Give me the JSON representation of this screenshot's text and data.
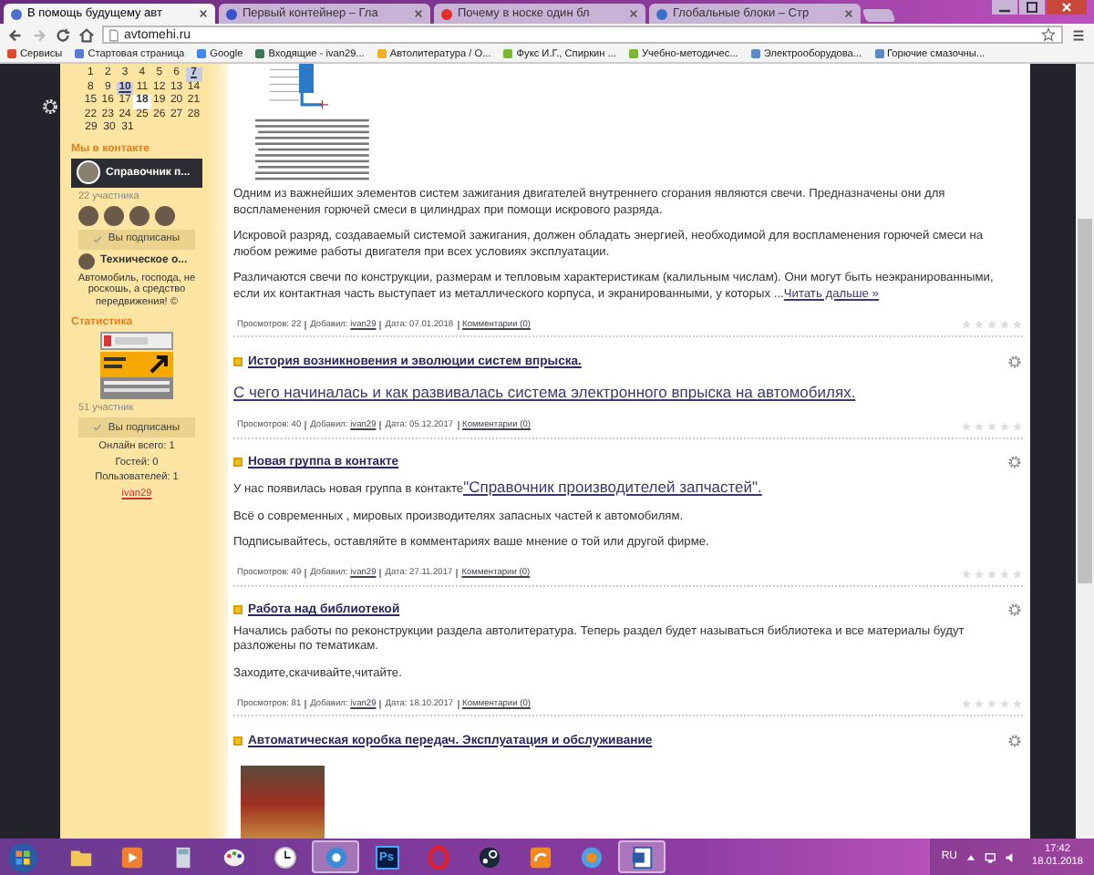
{
  "browser": {
    "tabs": [
      {
        "title": "В помощь будущему авт",
        "selected": true,
        "color": "#4a6fd0"
      },
      {
        "title": "Первый контейнер – Гла",
        "selected": false,
        "color": "#3a52c8"
      },
      {
        "title": "Почему в носке один бл",
        "selected": false,
        "color": "#e0302a"
      },
      {
        "title": "Глобальные блоки – Стр",
        "selected": false,
        "color": "#3a6fc8"
      }
    ],
    "address": "avtomehi.ru",
    "bookmarks": [
      {
        "label": "Сервисы",
        "color": "#e04a2a"
      },
      {
        "label": "Стартовая страница",
        "color": "#5a7ad8"
      },
      {
        "label": "Google",
        "color": "#4285f4"
      },
      {
        "label": "Входящие - ivan29...",
        "color": "#3a7a5a"
      },
      {
        "label": "Автолитература / О...",
        "color": "#f0b020"
      },
      {
        "label": "Фукс И.Г., Спиркин ...",
        "color": "#7ab830"
      },
      {
        "label": "Учебно-методичес...",
        "color": "#7ab830"
      },
      {
        "label": "Электрооборудова...",
        "color": "#5a8ac8"
      },
      {
        "label": "Горючие смазочны...",
        "color": "#5a8ac8"
      }
    ]
  },
  "sidebar": {
    "calendar": [
      [
        {
          "d": "1",
          "kind": "plain"
        },
        {
          "d": "2",
          "kind": "plain"
        },
        {
          "d": "3",
          "kind": "plain"
        },
        {
          "d": "4",
          "kind": "plain"
        },
        {
          "d": "5",
          "kind": "plain"
        },
        {
          "d": "6",
          "kind": "plain"
        },
        {
          "d": "7",
          "kind": "link"
        }
      ],
      [
        {
          "d": "8",
          "kind": "plain"
        },
        {
          "d": "9",
          "kind": "plain"
        },
        {
          "d": "10",
          "kind": "link"
        },
        {
          "d": "11",
          "kind": "plain"
        },
        {
          "d": "12",
          "kind": "plain"
        },
        {
          "d": "13",
          "kind": "plain"
        },
        {
          "d": "14",
          "kind": "plain"
        }
      ],
      [
        {
          "d": "15",
          "kind": "plain"
        },
        {
          "d": "16",
          "kind": "plain"
        },
        {
          "d": "17",
          "kind": "plain"
        },
        {
          "d": "18",
          "kind": "today"
        },
        {
          "d": "19",
          "kind": "plain"
        },
        {
          "d": "20",
          "kind": "plain"
        },
        {
          "d": "21",
          "kind": "plain"
        }
      ],
      [
        {
          "d": "22",
          "kind": "plain"
        },
        {
          "d": "23",
          "kind": "plain"
        },
        {
          "d": "24",
          "kind": "plain"
        },
        {
          "d": "25",
          "kind": "plain"
        },
        {
          "d": "26",
          "kind": "plain"
        },
        {
          "d": "27",
          "kind": "plain"
        },
        {
          "d": "28",
          "kind": "plain"
        }
      ],
      [
        {
          "d": "29",
          "kind": "plain"
        },
        {
          "d": "30",
          "kind": "plain"
        },
        {
          "d": "31",
          "kind": "plain"
        }
      ]
    ],
    "vk_heading": "Мы в контакте",
    "vk_group": "Справочник п...",
    "vk_members": "22 участника",
    "vk_button": "Вы подписаны",
    "vk_group_2": "Техническое о...",
    "quote": "Автомобиль, господа, не роскошь, а средство передвижения! ©",
    "stats_heading": "Статистика",
    "vk_members_2": "51 участник",
    "vk_button_2": "Вы подписаны",
    "online": [
      "Онлайн всего: 1",
      "Гостей: 0",
      "Пользователей: 1"
    ],
    "user": "ivan29"
  },
  "posts": [
    {
      "kind": "diagram",
      "paragraphs": [
        {
          "text": "Одним из важнейших элементов систем зажигания двигателей внутреннего сгорания являются свечи. Предназначены они для воспламенения горючей смеси в цилиндрах при помощи искрового разряда."
        },
        {
          "text": "Искровой разряд, создаваемый системой зажигания, должен обладать энергией, необходимой для воспламенения горючей смеси на любом режиме работы двигателя при всех условиях эксплуатации."
        },
        {
          "text": "Различаются свечи по конструкции, размерам и тепловым характеристикам (калильным числам). Они могут быть неэкранированными, если их контактная часть выступает из металлического корпуса, и экранированными, у которых ...",
          "link": "Читать дальше »"
        }
      ],
      "meta": {
        "views": "Просмотров: 22",
        "added": "Добавил:",
        "author": "ivan29",
        "date": "Дата: 07.01.2018",
        "comments": "Комментарии (0)"
      },
      "stars": 0
    },
    {
      "title": "История возникновения и эволюции систем впрыска.",
      "kind": "text",
      "paragraphs": [
        {
          "link": "С чего начиналась и как развивалась система электронного впрыска на автомобилях.",
          "big": true
        }
      ],
      "meta": {
        "views": "Просмотров: 40",
        "added": "Добавил:",
        "author": "ivan29",
        "date": "Дата: 05.12.2017",
        "comments": "Комментарии (0)"
      },
      "stars": 0
    },
    {
      "title": "Новая группа в контакте",
      "kind": "text",
      "paragraphs": [
        {
          "text": "У нас появилась новая группа в контакте",
          "link": "\"Справочник производителей запчастей\".",
          "big": true
        },
        {
          "text": "Всё о современных , мировых производителях запасных частей к автомобилям."
        },
        {
          "text": "Подписывайтесь, оставляйте в комментариях ваше мнение о той или другой фирме."
        }
      ],
      "meta": {
        "views": "Просмотров: 49",
        "added": "Добавил:",
        "author": "ivan29",
        "date": "Дата: 27.11.2017",
        "comments": "Комментарии (0)"
      },
      "stars": 0
    },
    {
      "title": "Работа над библиотекой",
      "kind": "text",
      "paragraphs": [
        {
          "text": "Начались работы по реконструкции раздела автолитература. Теперь раздел будет называться библиотека и все материалы будут разложены по тематикам."
        },
        {
          "text": "Заходите,скачивайте,читайте."
        }
      ],
      "meta": {
        "views": "Просмотров: 81",
        "added": "Добавил:",
        "author": "ivan29",
        "date": "Дата: 18.10.2017",
        "comments": "Комментарии (0)"
      },
      "stars": 0
    },
    {
      "title": "Автоматическая коробка передач. Эксплуатация и обслуживание",
      "kind": "photo"
    }
  ],
  "taskbar": {
    "apps": [
      {
        "kind": "folder",
        "selected": false
      },
      {
        "kind": "media",
        "selected": false
      },
      {
        "kind": "calculator",
        "selected": false
      },
      {
        "kind": "paint",
        "selected": false
      },
      {
        "kind": "clock",
        "selected": false
      },
      {
        "kind": "chrome",
        "selected": true
      },
      {
        "kind": "ps",
        "label": "Ps",
        "selected": false
      },
      {
        "kind": "opera",
        "selected": false
      },
      {
        "kind": "steam",
        "selected": false
      },
      {
        "kind": "uc",
        "selected": false
      },
      {
        "kind": "chat",
        "selected": false
      },
      {
        "kind": "word",
        "selected": true
      }
    ],
    "lang": "RU",
    "time": "17:42",
    "date": "18.01.2018"
  }
}
